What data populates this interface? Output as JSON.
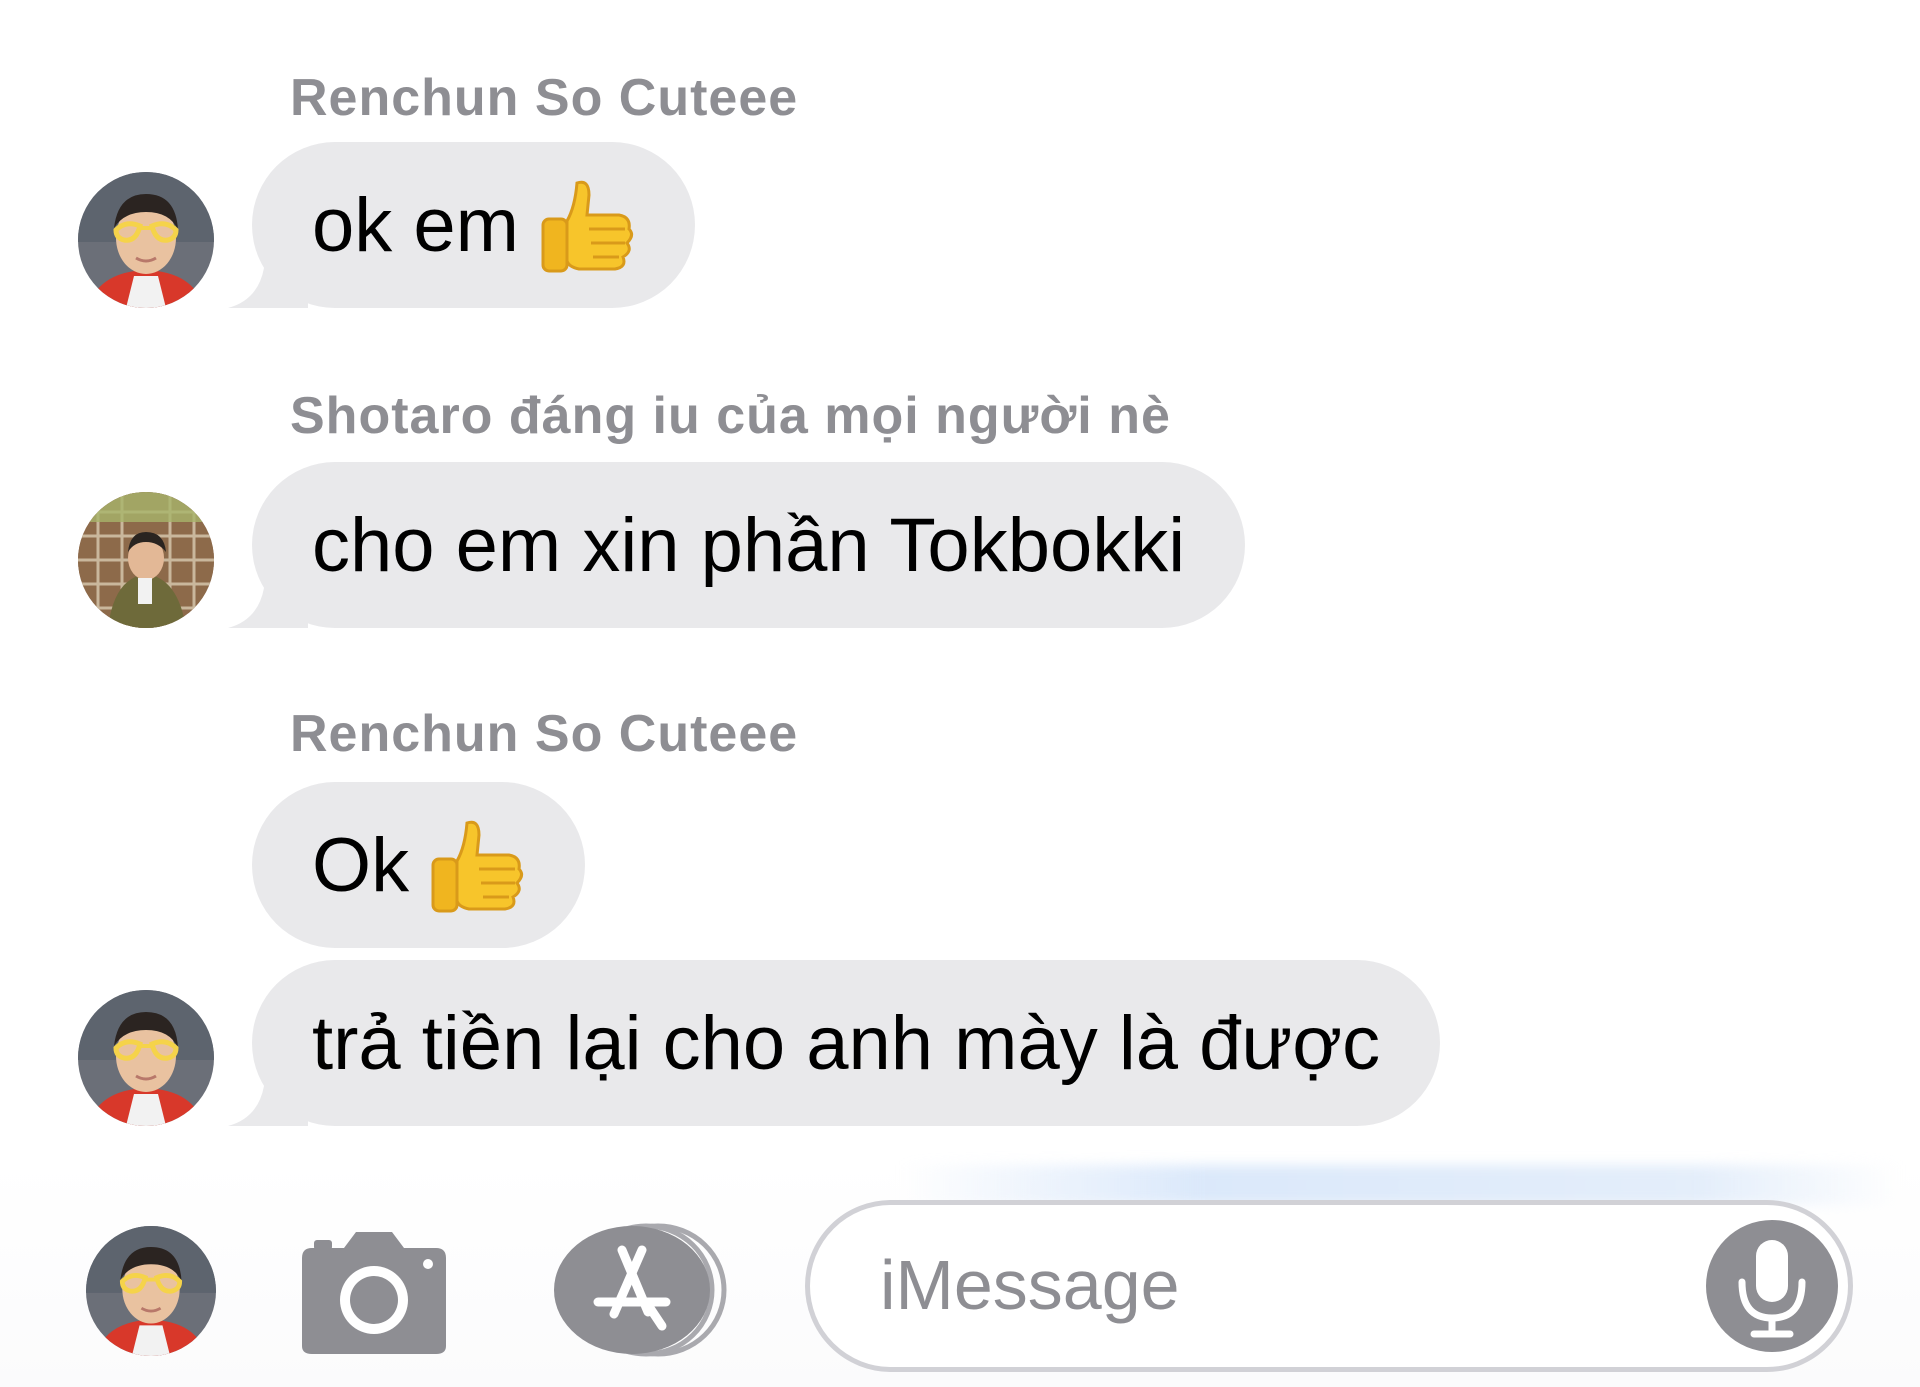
{
  "conversation": {
    "messages": [
      {
        "sender": "Renchun So Cuteee",
        "text": "ok em",
        "emoji": "thumbs-up"
      },
      {
        "sender": "Shotaro đáng iu của mọi người nè",
        "text": "cho em xin phần Tokbokki"
      },
      {
        "sender": "Renchun So Cuteee",
        "text": "Ok",
        "emoji": "thumbs-up"
      },
      {
        "text": "trả tiền lại cho anh mày là được"
      }
    ]
  },
  "input_bar": {
    "placeholder": "iMessage",
    "icons": [
      "camera-icon",
      "app-store-icon",
      "microphone-icon"
    ]
  },
  "colors": {
    "bubble": "#e9e9eb",
    "sender_name": "#8e8e93",
    "icon_gray": "#8e8e93",
    "field_border": "#d1d1d6",
    "thumb_yellow": "#f7c52b"
  }
}
